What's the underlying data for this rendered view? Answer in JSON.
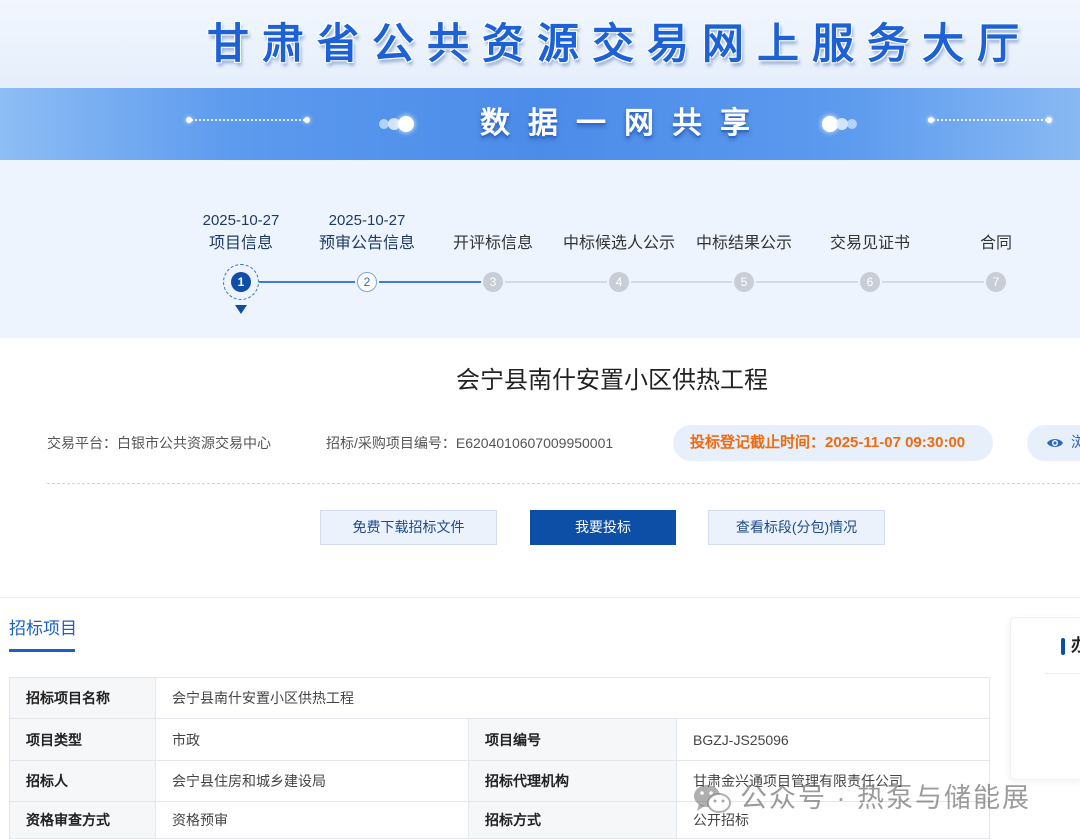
{
  "header": {
    "title": "甘肃省公共资源交易网上服务大厅"
  },
  "banner": {
    "slogan": "数据一网共享"
  },
  "progress": {
    "active_step": 1,
    "reached_through": 2,
    "steps": [
      {
        "number": "1",
        "date": "2025-10-27",
        "label": "项目信息"
      },
      {
        "number": "2",
        "date": "2025-10-27",
        "label": "预审公告信息"
      },
      {
        "number": "3",
        "label": "开评标信息"
      },
      {
        "number": "4",
        "label": "中标候选人公示"
      },
      {
        "number": "5",
        "label": "中标结果公示"
      },
      {
        "number": "6",
        "label": "交易见证书"
      },
      {
        "number": "7",
        "label": "合同"
      }
    ]
  },
  "project": {
    "title": "会宁县南什安置小区供热工程",
    "platform": {
      "label": "交易平台：",
      "value": "白银市公共资源交易中心"
    },
    "code": {
      "label": "招标/采购项目编号：",
      "value": "E6204010607009950001"
    },
    "deadline": {
      "label": "投标登记截止时间：",
      "value": "2025-11-07 09:30:00"
    },
    "views": {
      "icon": "eye-icon",
      "label": "浏"
    }
  },
  "actions": {
    "download_label": "免费下载招标文件",
    "bid_label": "我要投标",
    "sections_label": "查看标段(分包)情况"
  },
  "tabs": [
    {
      "label": "招标项目"
    }
  ],
  "table": {
    "rows": [
      [
        {
          "label": "招标项目名称",
          "value": "会宁县南什安置小区供热工程"
        }
      ],
      [
        {
          "label": "项目类型",
          "value": "市政"
        },
        {
          "label": "项目编号",
          "value": "BGZJ-JS25096"
        }
      ],
      [
        {
          "label": "招标人",
          "value": "会宁县住房和城乡建设局"
        },
        {
          "label": "招标代理机构",
          "value": "甘肃金兴通项目管理有限责任公司"
        }
      ],
      [
        {
          "label": "资格审查方式",
          "value": "资格预审"
        },
        {
          "label": "招标方式",
          "value": "公开招标"
        }
      ]
    ]
  },
  "side_panel": {
    "heading": "办"
  },
  "watermark": {
    "icon": "wechat-icon",
    "text": "公众号 · 热泵与储能展"
  },
  "colors": {
    "primary": "#0d4ea6",
    "link": "#1a5fc8",
    "deadline": "#f06a0f",
    "pending": "#c9ced6",
    "step_line": "#3d7bd8"
  }
}
